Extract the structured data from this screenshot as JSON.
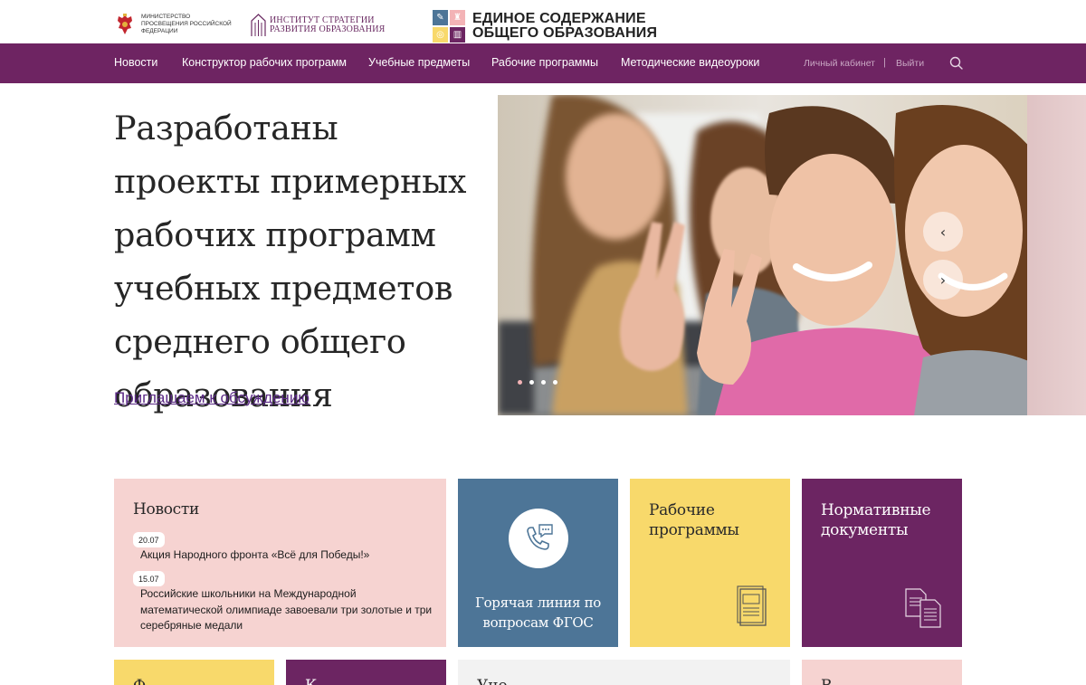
{
  "header": {
    "ministry_name": "Министерство просвещения Российской Федерации",
    "institute_name_line1": "Институт стратегии",
    "institute_name_line2": "развития образования",
    "site_name_line1": "ЕДИНОЕ СОДЕРЖАНИЕ",
    "site_name_line2": "ОБЩЕГО ОБРАЗОВАНИЯ"
  },
  "nav": {
    "items": [
      {
        "label": "Новости"
      },
      {
        "label": "Конструктор рабочих программ"
      },
      {
        "label": "Учебные предметы"
      },
      {
        "label": "Рабочие программы"
      },
      {
        "label": "Методические видеоуроки"
      }
    ],
    "account_label": "Личный кабинет",
    "separator": "|",
    "logout_label": "Выйти",
    "search_icon": "search-icon"
  },
  "hero": {
    "title": "Разработаны проекты примерных рабочих программ учебных предметов среднего общего образования",
    "link_label": "Приглашаем к обсуждению",
    "slider": {
      "prev_icon": "chevron-left-icon",
      "next_icon": "chevron-right-icon",
      "slide_count": 4,
      "active_slide": 1
    }
  },
  "tiles": {
    "news": {
      "title": "Новости",
      "items": [
        {
          "date": "20.07",
          "text": "Акция Народного фронта «Всё для Победы!»"
        },
        {
          "date": "15.07",
          "text": "Российские школьники на Международной математической олимпиаде завоевали три золотые и три серебряные медали"
        }
      ]
    },
    "hotline": {
      "title": "Горячая линия по вопросам ФГОС",
      "icon": "phone-chat-icon"
    },
    "programs": {
      "title": "Рабочие программы",
      "icon": "document-icon"
    },
    "documents": {
      "title": "Нормативные документы",
      "icon": "documents-icon"
    },
    "row2_left": {
      "title": "Ф"
    },
    "row2_second": {
      "title": "К"
    },
    "row2_wide": {
      "title": "Уче"
    },
    "row2_right": {
      "title": "В"
    }
  },
  "colors": {
    "nav_background": "#6e2462",
    "pink_tile": "#f6d3d1",
    "blue_tile": "#4d7597",
    "yellow_tile": "#f8d96b",
    "purple_tile": "#6c2562",
    "link": "#5b2a86"
  }
}
